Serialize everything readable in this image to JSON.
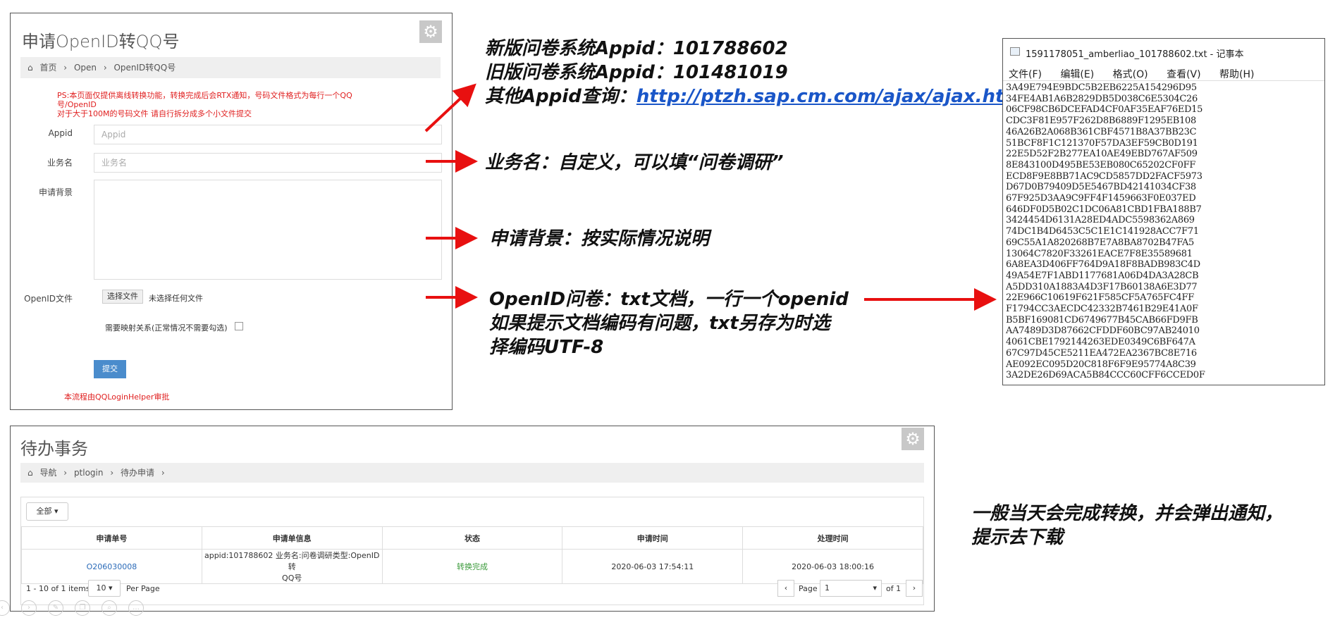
{
  "form_panel": {
    "title": "申请OpenID转QQ号",
    "breadcrumb": [
      "首页",
      "Open",
      "OpenID转QQ号"
    ],
    "notice": [
      "PS:本页面仅提供离线转换功能，转换完成后会RTX通知，号码文件格式为每行一个QQ",
      "号/OpenID",
      "对于大于100M的号码文件 请自行拆分成多个小文件提交"
    ],
    "appid_label": "Appid",
    "appid_placeholder": "Appid",
    "biz_label": "业务名",
    "biz_placeholder": "业务名",
    "bg_label": "申请背景",
    "file_label": "OpenID文件",
    "file_button": "选择文件",
    "file_status": "未选择任何文件",
    "mapping_label": "需要映射关系(正常情况不需要勾选)",
    "submit_label": "提交",
    "approval_note": "本流程由QQLoginHelper审批"
  },
  "annotations": {
    "appid_new": "新版问卷系统Appid：101788602",
    "appid_old": "旧版问卷系统Appid：101481019",
    "appid_other_prefix": "其他Appid查询：",
    "appid_other_link": "http://ptzh.sap.cm.com/ajax/ajax.html",
    "biz_note": "业务名：自定义，可以填“问卷调研”",
    "bg_note": "申请背景：按实际情况说明",
    "openid_note_1": "OpenID问卷：txt文档，一行一个openid",
    "openid_note_2": "如果提示文档编码有问题，txt另存为时选",
    "openid_note_3": "择编码UTF-8",
    "download_note_1": "一般当天会完成转换，并会弹出通知，",
    "download_note_2": "提示去下载"
  },
  "notepad": {
    "title": "1591178051_amberliao_101788602.txt - 记事本",
    "menu": [
      "文件(F)",
      "编辑(E)",
      "格式(O)",
      "查看(V)",
      "帮助(H)"
    ],
    "lines": [
      "3A49E794E9BDC5B2EB6225A154296D95",
      "34FE4AB1A6B2829DB5D038C6E5304C26",
      "06CF98CB6DCEFAD4CF0AF35EAF76ED15",
      "CDC3F81E957F262D8B6889F1295EB108",
      "46A26B2A068B361CBF4571B8A37BB23C",
      "51BCF8F1C121370F57DA3EF59CB0D191",
      "22E5D52F2B277EA10AE49EBD767AF509",
      "8E843100D495BE53EB080C65202CF0FF",
      "ECD8F9E8BB71AC9CD5857DD2FACF5973",
      "D67D0B79409D5E5467BD42141034CF38",
      "67F925D3AA9C9FF4F1459663F0E037ED",
      "646DF0D5B02C1DC06A81CBD1FBA188B7",
      "3424454D6131A28ED4ADC5598362A869",
      "74DC1B4D6453C5C1E1C141928ACC7F71",
      "69C55A1A820268B7E7A8BA8702B47FA5",
      "13064C7820F33261EACE7F8E35589681",
      "6A8EA3D406FF764D9A18F8BADB983C4D",
      "49A54E7F1ABD1177681A06D4DA3A28CB",
      "A5DD310A1883A4D3F17B60138A6E3D77",
      "22E966C10619F621F585CF5A765FC4FF",
      "F1794CC3AECDC42332B7461B29E41A0F",
      "B5BF169081CD6749677B45CAB66FD9FB",
      "AA7489D3D87662CFDDF60BC97AB24010",
      "4061CBE1792144263EDE0349C6BF647A",
      "67C97D45CE5211EA472EA2367BC8E716",
      "AE092EC095D20C818F6F9E95774A8C39",
      "3A2DE26D69ACA5B84CCC60CFF6CCED0F"
    ]
  },
  "todo_panel": {
    "title": "待办事务",
    "breadcrumb": [
      "导航",
      "ptlogin",
      "待办申请"
    ],
    "filter_label": "全部",
    "columns": [
      "申请单号",
      "申请单信息",
      "状态",
      "申请时间",
      "处理时间"
    ],
    "rows": [
      {
        "id": "O206030008",
        "info_1": "appid:101788602 业务名:问卷调研类型:OpenID转",
        "info_2": "QQ号",
        "status": "转换完成",
        "apply_time": "2020-06-03 17:54:11",
        "process_time": "2020-06-03 18:00:16"
      }
    ],
    "pager_summary": "1 - 10 of 1 items",
    "per_page_value": "10",
    "per_page_label": "Per Page",
    "page_label": "Page",
    "page_value": "1",
    "page_of": "of 1"
  },
  "colors": {
    "accent_blue": "#4a8ccc",
    "arrow_red": "#e81010",
    "status_green": "#3a9a3a",
    "link_blue": "#2a6ab8"
  }
}
